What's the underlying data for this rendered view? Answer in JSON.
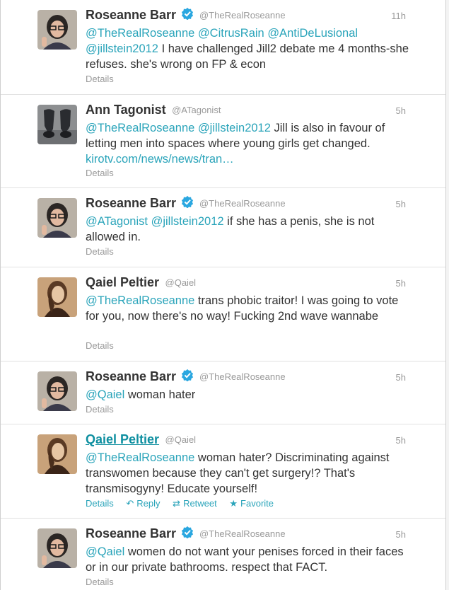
{
  "tweets": [
    {
      "name": "Roseanne Barr",
      "handle": "@TheRealRoseanne",
      "time": "11h",
      "segments": [
        {
          "t": "@TheRealRoseanne",
          "m": true
        },
        {
          "t": " ",
          "m": false
        },
        {
          "t": "@CitrusRain",
          "m": true
        },
        {
          "t": " ",
          "m": false
        },
        {
          "t": "@AntiDeLusional",
          "m": true
        },
        {
          "t": " ",
          "m": false
        },
        {
          "t": "@jillstein2012",
          "m": true
        },
        {
          "t": " I have challenged Jill2 debate me 4 months-she refuses. she's wrong on FP & econ",
          "m": false
        }
      ],
      "details_label": "Details"
    },
    {
      "name": "Ann Tagonist",
      "handle": "@ATagonist",
      "time": "5h",
      "segments": [
        {
          "t": "@TheRealRoseanne",
          "m": true
        },
        {
          "t": " ",
          "m": false
        },
        {
          "t": "@jillstein2012",
          "m": true
        },
        {
          "t": " Jill is also in favour of letting men into spaces where young girls get changed. ",
          "m": false
        },
        {
          "t": "kirotv.com/news/news/tran…",
          "m": true
        }
      ],
      "details_label": "Details"
    },
    {
      "name": "Roseanne Barr",
      "handle": "@TheRealRoseanne",
      "time": "5h",
      "segments": [
        {
          "t": "@ATagonist",
          "m": true
        },
        {
          "t": " ",
          "m": false
        },
        {
          "t": "@jillstein2012",
          "m": true
        },
        {
          "t": " if she has a penis, she is not allowed in.",
          "m": false
        }
      ],
      "details_label": "Details"
    },
    {
      "name": "Qaiel Peltier",
      "handle": "@Qaiel",
      "time": "5h",
      "segments": [
        {
          "t": "@TheRealRoseanne",
          "m": true
        },
        {
          "t": " trans phobic traitor! I was going to vote for you, now there's no way! Fucking 2nd wave wannabe",
          "m": false
        }
      ],
      "details_label": "Details"
    },
    {
      "name": "Roseanne Barr",
      "handle": "@TheRealRoseanne",
      "time": "5h",
      "segments": [
        {
          "t": "@Qaiel",
          "m": true
        },
        {
          "t": " woman hater",
          "m": false
        }
      ],
      "details_label": "Details"
    },
    {
      "name": "Qaiel Peltier",
      "handle": "@Qaiel",
      "time": "5h",
      "segments": [
        {
          "t": "@TheRealRoseanne",
          "m": true
        },
        {
          "t": " woman hater? Discriminating against transwomen because they can't get surgery!? That's transmisogyny! Educate yourself!",
          "m": false
        }
      ],
      "details_label": "Details",
      "actions": {
        "reply_label": "Reply",
        "retweet_label": "Retweet",
        "favorite_label": "Favorite"
      }
    },
    {
      "name": "Roseanne Barr",
      "handle": "@TheRealRoseanne",
      "time": "5h",
      "segments": [
        {
          "t": "@Qaiel",
          "m": true
        },
        {
          "t": " women do not want your penises forced in their faces or in our private bathrooms. respect that FACT.",
          "m": false
        }
      ],
      "details_label": "Details"
    }
  ],
  "colors": {
    "link": "#2aa4ba",
    "name": "#333333",
    "meta": "#999999",
    "verified": "#2aa7e0"
  }
}
